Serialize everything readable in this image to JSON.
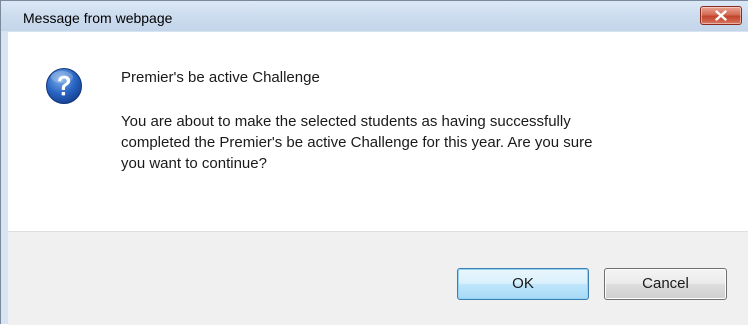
{
  "window": {
    "title": "Message from webpage",
    "close_icon": "close-icon",
    "close_color": "#c7432b"
  },
  "message": {
    "icon": "question-icon",
    "heading": "Premier's be active Challenge",
    "lines": [
      "You are about to make the selected students as having successfully",
      "completed the Premier's be active Challenge for this year. Are you sure",
      "you want to continue?"
    ]
  },
  "buttons": {
    "ok_label": "OK",
    "cancel_label": "Cancel"
  }
}
